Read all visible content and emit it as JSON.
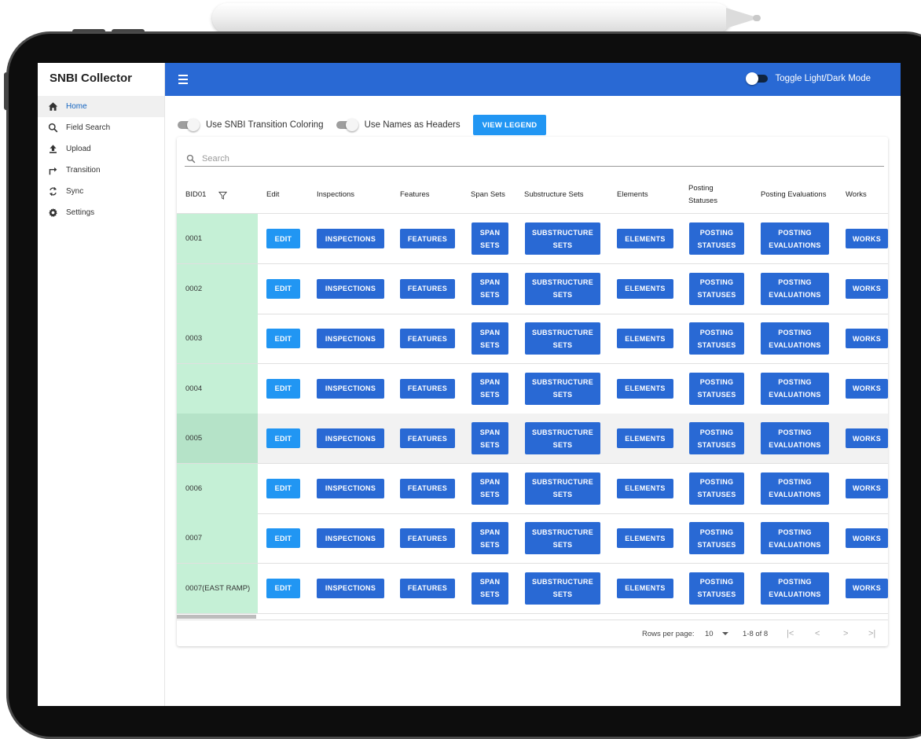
{
  "sidebar": {
    "brand": "SNBI Collector",
    "items": [
      {
        "label": "Home",
        "icon": "home-icon",
        "active": true
      },
      {
        "label": "Field Search",
        "icon": "search-icon",
        "active": false
      },
      {
        "label": "Upload",
        "icon": "upload-icon",
        "active": false
      },
      {
        "label": "Transition",
        "icon": "transition-arrow-icon",
        "active": false
      },
      {
        "label": "Sync",
        "icon": "sync-icon",
        "active": false
      },
      {
        "label": "Settings",
        "icon": "gear-icon",
        "active": false
      }
    ]
  },
  "header": {
    "menu_icon": "hamburger-icon",
    "toggle_label": "Toggle Light/Dark Mode"
  },
  "controls": {
    "coloring_label": "Use SNBI Transition Coloring",
    "names_label": "Use Names as Headers",
    "legend_button": "VIEW LEGEND"
  },
  "search": {
    "placeholder": "Search"
  },
  "table": {
    "headers": {
      "bid": "BID01",
      "edit": "Edit",
      "inspections": "Inspections",
      "features": "Features",
      "spansets": "Span Sets",
      "substructure": "Substructure Sets",
      "elements": "Elements",
      "posting_line1": "Posting",
      "posting_line2": "Statuses",
      "evaluations": "Posting Evaluations",
      "works": "Works"
    },
    "buttons": {
      "edit": "EDIT",
      "inspections": "INSPECTIONS",
      "features": "FEATURES",
      "spansets_line1": "SPAN",
      "spansets_line2": "SETS",
      "substructure_line1": "SUBSTRUCTURE",
      "substructure_line2": "SETS",
      "elements": "ELEMENTS",
      "posting_line1": "POSTING",
      "posting_line2": "STATUSES",
      "evaluations_line1": "POSTING",
      "evaluations_line2": "EVALUATIONS",
      "works": "WORKS"
    },
    "rows": [
      {
        "bid": "0001"
      },
      {
        "bid": "0002"
      },
      {
        "bid": "0003"
      },
      {
        "bid": "0004"
      },
      {
        "bid": "0005"
      },
      {
        "bid": "0006"
      },
      {
        "bid": "0007"
      },
      {
        "bid": "0007(EAST RAMP)"
      }
    ]
  },
  "pagination": {
    "rows_per_page_label": "Rows per page:",
    "rows_per_page_value": "10",
    "range": "1-8 of 8",
    "first": "|<",
    "prev": "<",
    "next": ">",
    "last": ">|"
  },
  "colors": {
    "app_bar": "#2969d4",
    "primary_button": "#2969d4",
    "edit_button": "#2196f3",
    "bid_cell": "#c5f0d6"
  }
}
